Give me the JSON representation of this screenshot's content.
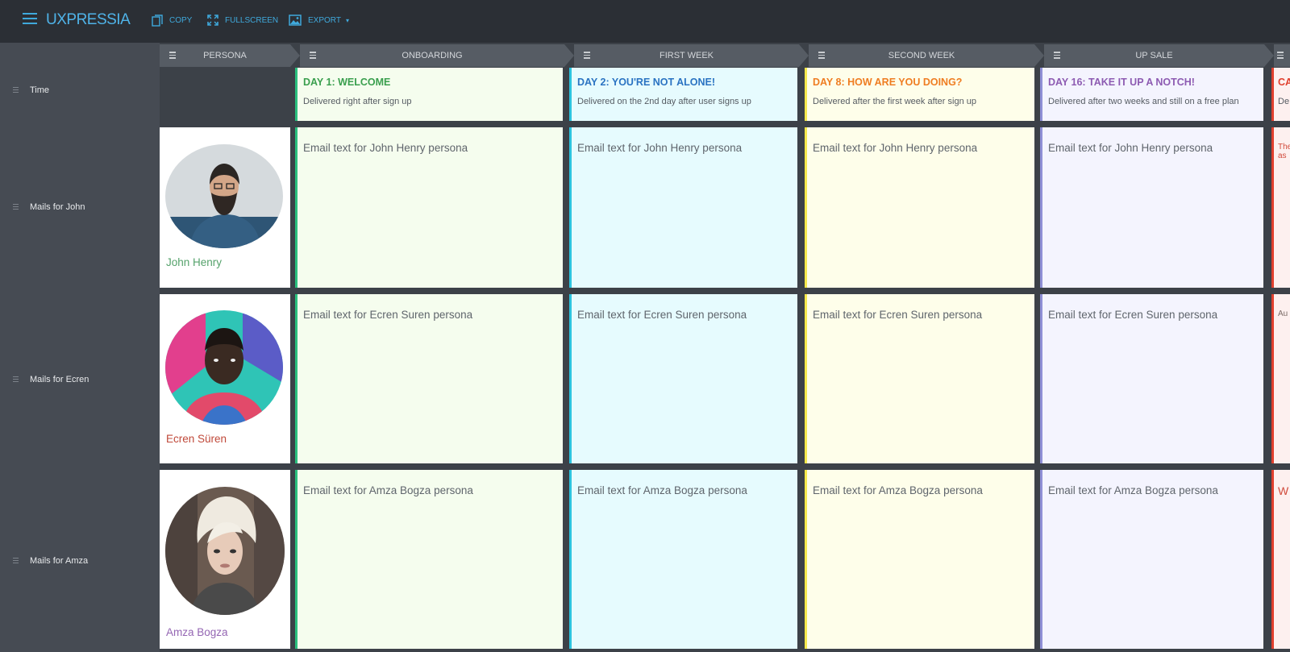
{
  "app": {
    "logo": "UXPRESSIA",
    "toolbar": {
      "copy_label": "COPY",
      "fullscreen_label": "FULLSCREEN",
      "export_label": "EXPORT",
      "export_caret": "▾"
    },
    "accent_color": "#3fa9dc"
  },
  "stages": [
    {
      "label": "PERSONA"
    },
    {
      "label": "ONBOARDING"
    },
    {
      "label": "FIRST WEEK"
    },
    {
      "label": "SECOND WEEK"
    },
    {
      "label": "UP SALE"
    }
  ],
  "rows": [
    {
      "label": "Time"
    },
    {
      "label": "Mails for John"
    },
    {
      "label": "Mails for Ecren"
    },
    {
      "label": "Mails for Amza"
    }
  ],
  "time_cells": [
    {
      "title": "DAY 1: WELCOME",
      "subtitle": "Delivered right after sign up",
      "color": "#3a9f4e",
      "bg": "#f5fdee",
      "bar": "#2bbf7e"
    },
    {
      "title": "DAY 2: YOU'RE NOT ALONE!",
      "subtitle": "Delivered on the 2nd day after user signs up",
      "color": "#2a73c2",
      "bg": "#e6fbfe",
      "bar": "#2cc3de"
    },
    {
      "title": "DAY 8: HOW ARE YOU DOING?",
      "subtitle": "Delivered after the first week after sign up",
      "color": "#ef7d22",
      "bg": "#fefeea",
      "bar": "#f5e84c"
    },
    {
      "title": "DAY 16: TAKE IT UP A NOTCH!",
      "subtitle": "Delivered after two weeks and still on a free plan",
      "color": "#8d5bb2",
      "bg": "#f4f4fe",
      "bar": "#8f8fd6"
    },
    {
      "title": "CA",
      "subtitle": "De",
      "color": "#e0402e",
      "bg": "#fdf0ef",
      "bar": "#e0402e"
    }
  ],
  "personas": [
    {
      "name": "John Henry",
      "name_color": "#55a26b",
      "mail_text": "Email text for John Henry persona",
      "edge_text": [
        "The",
        "as"
      ]
    },
    {
      "name": "Ecren Süren",
      "name_color": "#c0493a",
      "mail_text": "Email text for Ecren Suren persona",
      "edge_text": [
        "Au"
      ]
    },
    {
      "name": "Amza Bogza",
      "name_color": "#9466b3",
      "mail_text": "Email text for Amza Bogza persona",
      "edge_text": [
        "W"
      ]
    }
  ]
}
